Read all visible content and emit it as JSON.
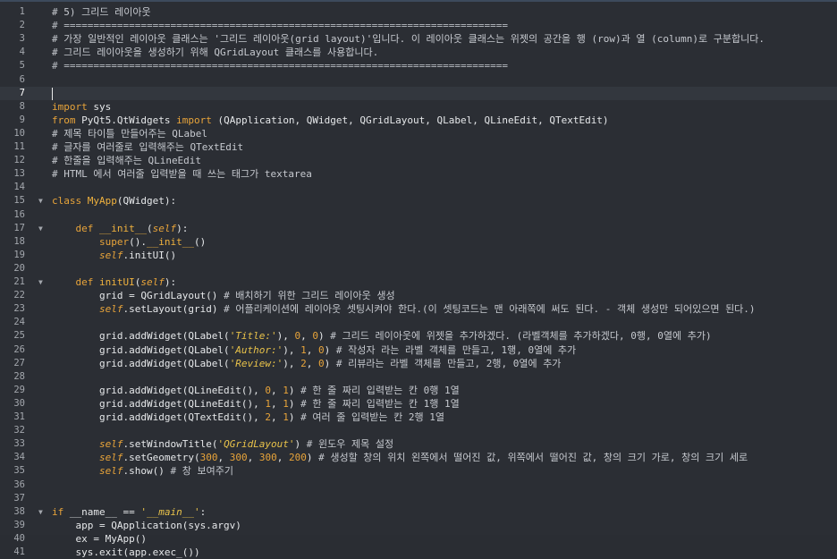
{
  "editor": {
    "active_line": 7,
    "lines": [
      {
        "n": "1",
        "fold": false,
        "segs": [
          {
            "t": "# 5) 그리드 레이아웃",
            "c": "cm"
          }
        ]
      },
      {
        "n": "2",
        "fold": false,
        "segs": [
          {
            "t": "# ===========================================================================",
            "c": "cm-d"
          }
        ]
      },
      {
        "n": "3",
        "fold": false,
        "segs": [
          {
            "t": "# 가장 일반적인 레이아웃 클래스는 '그리드 레이아웃(grid layout)'입니다. 이 레이아웃 클래스는 위젯의 공간을 행 (row)과 열 (column)로 구분합니다.",
            "c": "cm"
          }
        ]
      },
      {
        "n": "4",
        "fold": false,
        "segs": [
          {
            "t": "# 그리드 레이아웃을 생성하기 위해 QGridLayout 클래스를 사용합니다.",
            "c": "cm"
          }
        ]
      },
      {
        "n": "5",
        "fold": false,
        "segs": [
          {
            "t": "# ===========================================================================",
            "c": "cm-d"
          }
        ]
      },
      {
        "n": "6",
        "fold": false,
        "segs": []
      },
      {
        "n": "7",
        "fold": false,
        "segs": [],
        "caret": true
      },
      {
        "n": "8",
        "fold": false,
        "segs": [
          {
            "t": "import",
            "c": "kw"
          },
          {
            "t": " sys",
            "c": "id"
          }
        ]
      },
      {
        "n": "9",
        "fold": false,
        "segs": [
          {
            "t": "from",
            "c": "kw"
          },
          {
            "t": " PyQt5.QtWidgets ",
            "c": "id"
          },
          {
            "t": "import",
            "c": "kw"
          },
          {
            "t": " (QApplication, QWidget, QGridLayout, QLabel, QLineEdit, QTextEdit)",
            "c": "id"
          }
        ]
      },
      {
        "n": "10",
        "fold": false,
        "segs": [
          {
            "t": "# 제목 타이틀 만들어주는 QLabel",
            "c": "cm"
          }
        ]
      },
      {
        "n": "11",
        "fold": false,
        "segs": [
          {
            "t": "# 글자를 여러줄로 입력해주는 QTextEdit",
            "c": "cm"
          }
        ]
      },
      {
        "n": "12",
        "fold": false,
        "segs": [
          {
            "t": "# 한줄을 입력해주는 QLineEdit",
            "c": "cm"
          }
        ]
      },
      {
        "n": "13",
        "fold": false,
        "segs": [
          {
            "t": "# HTML 에서 여러줄 입력받을 때 쓰는 태그가 textarea",
            "c": "cm"
          }
        ]
      },
      {
        "n": "14",
        "fold": false,
        "segs": []
      },
      {
        "n": "15",
        "fold": true,
        "segs": [
          {
            "t": "class",
            "c": "kw"
          },
          {
            "t": " ",
            "c": "id"
          },
          {
            "t": "MyApp",
            "c": "fn"
          },
          {
            "t": "(QWidget):",
            "c": "id"
          }
        ]
      },
      {
        "n": "16",
        "fold": false,
        "segs": []
      },
      {
        "n": "17",
        "fold": true,
        "segs": [
          {
            "t": "    def",
            "c": "kw"
          },
          {
            "t": " ",
            "c": "id"
          },
          {
            "t": "__init__",
            "c": "fn"
          },
          {
            "t": "(",
            "c": "id"
          },
          {
            "t": "self",
            "c": "sf"
          },
          {
            "t": "):",
            "c": "id"
          }
        ]
      },
      {
        "n": "18",
        "fold": false,
        "segs": [
          {
            "t": "        ",
            "c": "id"
          },
          {
            "t": "super",
            "c": "kw"
          },
          {
            "t": "().",
            "c": "id"
          },
          {
            "t": "__init__",
            "c": "fn"
          },
          {
            "t": "()",
            "c": "id"
          }
        ]
      },
      {
        "n": "19",
        "fold": false,
        "segs": [
          {
            "t": "        ",
            "c": "id"
          },
          {
            "t": "self",
            "c": "sf"
          },
          {
            "t": ".initUI()",
            "c": "id"
          }
        ]
      },
      {
        "n": "20",
        "fold": false,
        "segs": []
      },
      {
        "n": "21",
        "fold": true,
        "segs": [
          {
            "t": "    def",
            "c": "kw"
          },
          {
            "t": " ",
            "c": "id"
          },
          {
            "t": "initUI",
            "c": "fn"
          },
          {
            "t": "(",
            "c": "id"
          },
          {
            "t": "self",
            "c": "sf"
          },
          {
            "t": "):",
            "c": "id"
          }
        ]
      },
      {
        "n": "22",
        "fold": false,
        "segs": [
          {
            "t": "        grid = QGridLayout() ",
            "c": "id"
          },
          {
            "t": "# 배치하기 위한 그리드 레이아웃 생성",
            "c": "cm"
          }
        ]
      },
      {
        "n": "23",
        "fold": false,
        "segs": [
          {
            "t": "        ",
            "c": "id"
          },
          {
            "t": "self",
            "c": "sf"
          },
          {
            "t": ".setLayout(grid) ",
            "c": "id"
          },
          {
            "t": "# 어플리케이션에 레이아웃 셋팅시켜야 한다.(이 셋팅코드는 맨 아래쪽에 써도 된다. - 객체 생성만 되어있으면 된다.)",
            "c": "cm"
          }
        ]
      },
      {
        "n": "24",
        "fold": false,
        "segs": []
      },
      {
        "n": "25",
        "fold": false,
        "segs": [
          {
            "t": "        grid.addWidget(QLabel(",
            "c": "id"
          },
          {
            "t": "'Title:'",
            "c": "st"
          },
          {
            "t": "), ",
            "c": "id"
          },
          {
            "t": "0",
            "c": "nm"
          },
          {
            "t": ", ",
            "c": "id"
          },
          {
            "t": "0",
            "c": "nm"
          },
          {
            "t": ") ",
            "c": "id"
          },
          {
            "t": "# 그리드 레이아웃에 위젯을 추가하겠다. (라벨객체를 추가하겠다, 0행, 0열에 추가)",
            "c": "cm"
          }
        ]
      },
      {
        "n": "26",
        "fold": false,
        "segs": [
          {
            "t": "        grid.addWidget(QLabel(",
            "c": "id"
          },
          {
            "t": "'Author:'",
            "c": "st"
          },
          {
            "t": "), ",
            "c": "id"
          },
          {
            "t": "1",
            "c": "nm"
          },
          {
            "t": ", ",
            "c": "id"
          },
          {
            "t": "0",
            "c": "nm"
          },
          {
            "t": ") ",
            "c": "id"
          },
          {
            "t": "# 작성자 라는 라벨 객체를 만들고, 1행, 0열에 추가",
            "c": "cm"
          }
        ]
      },
      {
        "n": "27",
        "fold": false,
        "segs": [
          {
            "t": "        grid.addWidget(QLabel(",
            "c": "id"
          },
          {
            "t": "'Review:'",
            "c": "st"
          },
          {
            "t": "), ",
            "c": "id"
          },
          {
            "t": "2",
            "c": "nm"
          },
          {
            "t": ", ",
            "c": "id"
          },
          {
            "t": "0",
            "c": "nm"
          },
          {
            "t": ") ",
            "c": "id"
          },
          {
            "t": "# 리뷰라는 라벨 객체를 만들고, 2행, 0열에 추가",
            "c": "cm"
          }
        ]
      },
      {
        "n": "28",
        "fold": false,
        "segs": []
      },
      {
        "n": "29",
        "fold": false,
        "segs": [
          {
            "t": "        grid.addWidget(QLineEdit(), ",
            "c": "id"
          },
          {
            "t": "0",
            "c": "nm"
          },
          {
            "t": ", ",
            "c": "id"
          },
          {
            "t": "1",
            "c": "nm"
          },
          {
            "t": ") ",
            "c": "id"
          },
          {
            "t": "# 한 줄 짜리 입력받는 칸 0행 1열",
            "c": "cm"
          }
        ]
      },
      {
        "n": "30",
        "fold": false,
        "segs": [
          {
            "t": "        grid.addWidget(QLineEdit(), ",
            "c": "id"
          },
          {
            "t": "1",
            "c": "nm"
          },
          {
            "t": ", ",
            "c": "id"
          },
          {
            "t": "1",
            "c": "nm"
          },
          {
            "t": ") ",
            "c": "id"
          },
          {
            "t": "# 한 줄 짜리 입력받는 칸 1행 1열",
            "c": "cm"
          }
        ]
      },
      {
        "n": "31",
        "fold": false,
        "segs": [
          {
            "t": "        grid.addWidget(QTextEdit(), ",
            "c": "id"
          },
          {
            "t": "2",
            "c": "nm"
          },
          {
            "t": ", ",
            "c": "id"
          },
          {
            "t": "1",
            "c": "nm"
          },
          {
            "t": ") ",
            "c": "id"
          },
          {
            "t": "# 여러 줄 입력받는 칸 2행 1열",
            "c": "cm"
          }
        ]
      },
      {
        "n": "32",
        "fold": false,
        "segs": []
      },
      {
        "n": "33",
        "fold": false,
        "segs": [
          {
            "t": "        ",
            "c": "id"
          },
          {
            "t": "self",
            "c": "sf"
          },
          {
            "t": ".setWindowTitle(",
            "c": "id"
          },
          {
            "t": "'QGridLayout'",
            "c": "st"
          },
          {
            "t": ") ",
            "c": "id"
          },
          {
            "t": "# 윈도우 제목 설정",
            "c": "cm"
          }
        ]
      },
      {
        "n": "34",
        "fold": false,
        "segs": [
          {
            "t": "        ",
            "c": "id"
          },
          {
            "t": "self",
            "c": "sf"
          },
          {
            "t": ".setGeometry(",
            "c": "id"
          },
          {
            "t": "300",
            "c": "nm"
          },
          {
            "t": ", ",
            "c": "id"
          },
          {
            "t": "300",
            "c": "nm"
          },
          {
            "t": ", ",
            "c": "id"
          },
          {
            "t": "300",
            "c": "nm"
          },
          {
            "t": ", ",
            "c": "id"
          },
          {
            "t": "200",
            "c": "nm"
          },
          {
            "t": ") ",
            "c": "id"
          },
          {
            "t": "# 생성할 창의 위치 왼쪽에서 떨어진 값, 위쪽에서 떨어진 값, 창의 크기 가로, 창의 크기 세로",
            "c": "cm"
          }
        ]
      },
      {
        "n": "35",
        "fold": false,
        "segs": [
          {
            "t": "        ",
            "c": "id"
          },
          {
            "t": "self",
            "c": "sf"
          },
          {
            "t": ".show() ",
            "c": "id"
          },
          {
            "t": "# 창 보여주기",
            "c": "cm"
          }
        ]
      },
      {
        "n": "36",
        "fold": false,
        "segs": []
      },
      {
        "n": "37",
        "fold": false,
        "segs": []
      },
      {
        "n": "38",
        "fold": true,
        "segs": [
          {
            "t": "if",
            "c": "kw"
          },
          {
            "t": " __name__ == ",
            "c": "id"
          },
          {
            "t": "'__main__'",
            "c": "st"
          },
          {
            "t": ":",
            "c": "id"
          }
        ]
      },
      {
        "n": "39",
        "fold": false,
        "segs": [
          {
            "t": "    app = QApplication(sys.argv)",
            "c": "id"
          }
        ]
      },
      {
        "n": "40",
        "fold": false,
        "segs": [
          {
            "t": "    ex = MyApp()",
            "c": "id"
          }
        ]
      },
      {
        "n": "41",
        "fold": false,
        "segs": [
          {
            "t": "    sys.exit(app.exec_())",
            "c": "id"
          }
        ]
      }
    ]
  }
}
